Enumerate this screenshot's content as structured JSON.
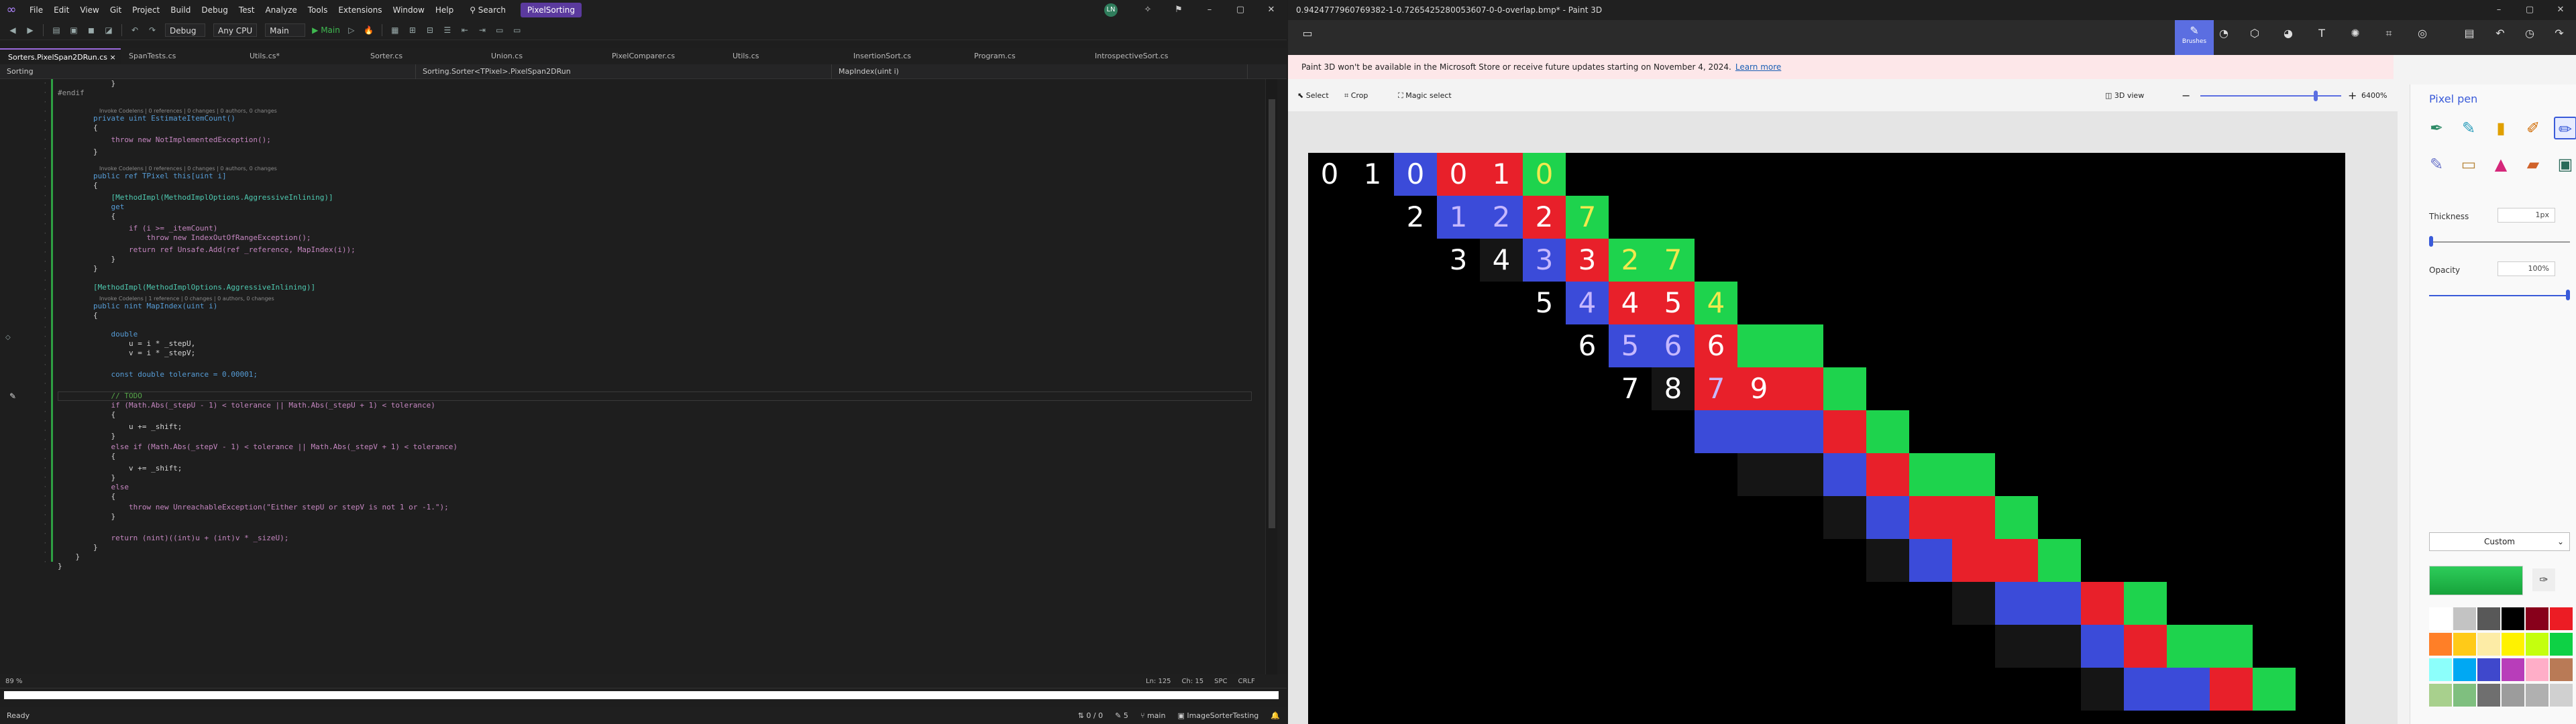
{
  "vs": {
    "menu": [
      "File",
      "Edit",
      "View",
      "Git",
      "Project",
      "Build",
      "Debug",
      "Test",
      "Analyze",
      "Tools",
      "Extensions",
      "Window",
      "Help"
    ],
    "search_label": "Search",
    "solution_name": "PixelSorting",
    "avatar_initials": "LN",
    "toolbar": {
      "config": "Debug",
      "platform": "Any CPU",
      "startup": "Main",
      "run_label": "Main"
    },
    "tabs": [
      "Sorters.PixelSpan2DRun.cs",
      "SpanTests.cs",
      "Utils.cs*",
      "Sorter.cs",
      "Union.cs",
      "PixelComparer.cs",
      "Utils.cs",
      "InsertionSort.cs",
      "Program.cs",
      "IntrospectiveSort.cs"
    ],
    "active_tab_close": "×",
    "nav": {
      "project": "Sorting",
      "type": "Sorting.Sorter<TPixel>.PixelSpan2DRun",
      "member": "MapIndex(uint i)"
    },
    "code": {
      "lens_1": "Invoke Codelens | 0 references | 0 changes | 0 authors, 0 changes",
      "lens_2": "Invoke Codelens | 0 references | 0 changes | 0 authors, 0 changes",
      "lens_3": "Invoke Codelens | 1 reference | 0 changes | 0 authors, 0 changes",
      "l01": "            }",
      "l02": "#endif",
      "l03": "        private uint EstimateItemCount()",
      "l04": "        {",
      "l05": "            throw new NotImplementedException();",
      "l06": "        }",
      "l07": "        public ref TPixel this[uint i]",
      "l08": "        {",
      "l09": "            [MethodImpl(MethodImplOptions.AggressiveInlining)]",
      "l10": "            get",
      "l11": "            {",
      "l12": "                if (i >= _itemCount)",
      "l13": "                    throw new IndexOutOfRangeException();",
      "l14": "                return ref Unsafe.Add(ref _reference, MapIndex(i));",
      "l15": "            }",
      "l16": "        }",
      "l17": "        [MethodImpl(MethodImplOptions.AggressiveInlining)]",
      "l18": "        public nint MapIndex(uint i)",
      "l19": "        {",
      "l20": "            double",
      "l21": "                u = i * _stepU,",
      "l22": "                v = i * _stepV;",
      "l23": "            const double tolerance = 0.00001;",
      "l24": "            // TODO",
      "l25": "            if (Math.Abs(_stepU - 1) < tolerance || Math.Abs(_stepU + 1) < tolerance)",
      "l26": "            {",
      "l27": "                u += _shift;",
      "l28": "            }",
      "l29": "            else if (Math.Abs(_stepV - 1) < tolerance || Math.Abs(_stepV + 1) < tolerance)",
      "l30": "            {",
      "l31": "                v += _shift;",
      "l32": "            }",
      "l33": "            else",
      "l34": "            {",
      "l35": "                throw new UnreachableException(\"Either stepU or stepV is not 1 or -1.\");",
      "l36": "            }",
      "l37": "            return (nint)((int)u + (int)v * _sizeU);",
      "l38": "        }",
      "l39": "    }",
      "l40": "}"
    },
    "editor_status": {
      "zoom": "89 %",
      "position": "Ln: 125",
      "col": "Ch: 15",
      "spc": "SPC",
      "eol": "CRLF"
    },
    "status": {
      "ready": "Ready",
      "updown": "0 / 0",
      "pencil": "5",
      "branch": "main",
      "repo": "ImageSorterTesting"
    }
  },
  "paint": {
    "title": "0.9424777960769382-1-0.7265425280053607-0-0-overlap.bmp* - Paint 3D",
    "ribbon": {
      "brushes": "Brushes"
    },
    "banner_text": "Paint 3D won't be available in the Microsoft Store or receive future updates starting on November 4, 2024.",
    "banner_link": "Learn more",
    "select": "Select",
    "crop": "Crop",
    "magic": "Magic select",
    "view3d": "3D view",
    "zoom_value": "6400%",
    "zoom_level": 0.82,
    "side": {
      "title": "Pixel pen",
      "thickness_label": "Thickness",
      "thickness_value": "1px",
      "opacity_label": "Opacity",
      "opacity_value": "100%",
      "color_mode": "Custom"
    },
    "palette": [
      "#ffffff",
      "#c3c3c3",
      "#585858",
      "#000000",
      "#88001b",
      "#ec1c24",
      "#ff7f27",
      "#ffca18",
      "#fdeca6",
      "#fff200",
      "#c4ff0e",
      "#0ed145",
      "#8cfffb",
      "#00a8f3",
      "#3f48cc",
      "#b83dba",
      "#ffaec8",
      "#b97a56",
      "#a8d08d",
      "#7fbf7f",
      "#6f6f6f",
      "#9c9c9c",
      "#b0b0b0",
      "#d0d0d0"
    ],
    "canvas_colors": {
      "blue": "#3b4bd9",
      "red": "#e8202a",
      "green": "#1ed34d",
      "dark": "#151515"
    },
    "handwriting": [
      "0",
      "1",
      "0",
      "0",
      "1",
      "0",
      "2",
      "1",
      "2",
      "2",
      "7",
      "3",
      "4",
      "3",
      "3",
      "2",
      "7",
      "5",
      "4",
      "4",
      "5",
      "4",
      "6",
      "5",
      "6",
      "6",
      "7",
      "8",
      "7",
      "9"
    ]
  }
}
